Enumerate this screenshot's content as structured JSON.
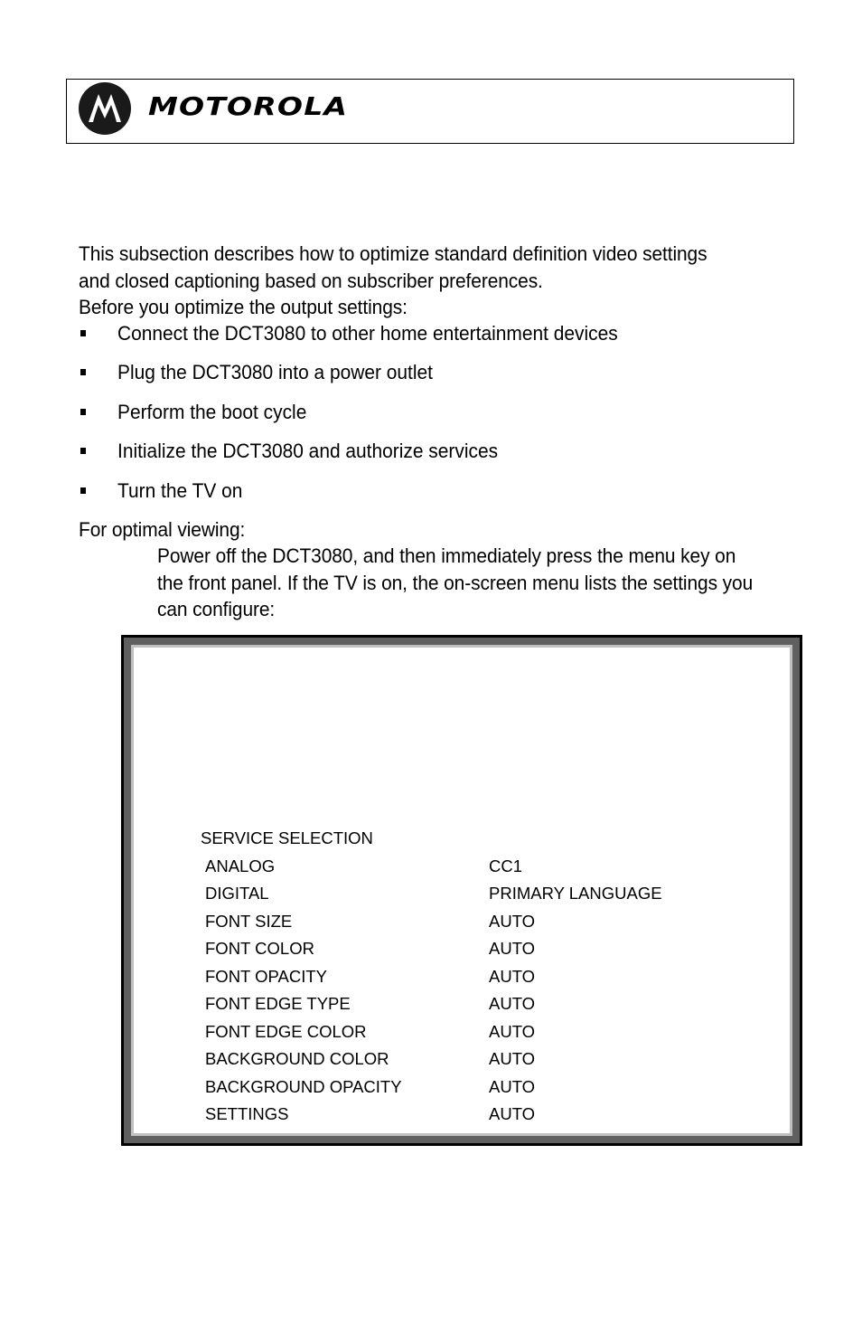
{
  "header": {
    "brand": "MOTOROLA",
    "logo_icon": "motorola-batwing-logo"
  },
  "intro": {
    "paragraph": "This subsection describes how to optimize standard definition video settings and closed captioning based on subscriber preferences.",
    "before_label": "Before you optimize the output settings:"
  },
  "prerequisites": [
    "Connect the DCT3080 to other home entertainment devices",
    "Plug the DCT3080 into a power outlet",
    "Perform the boot cycle",
    "Initialize the DCT3080 and authorize services",
    "Turn the TV on"
  ],
  "optimal": {
    "label": "For optimal viewing:",
    "instruction": "Power off the DCT3080, and then immediately press the menu key on the front panel. If the TV is on, the on-screen menu lists the settings you can configure:"
  },
  "tv_menu": {
    "title": "SERVICE SELECTION",
    "rows": [
      {
        "label": "ANALOG",
        "value": "CC1"
      },
      {
        "label": "DIGITAL",
        "value": "PRIMARY LANGUAGE"
      },
      {
        "label": "FONT SIZE",
        "value": "AUTO"
      },
      {
        "label": "FONT COLOR",
        "value": "AUTO"
      },
      {
        "label": "FONT OPACITY",
        "value": "AUTO"
      },
      {
        "label": "FONT EDGE TYPE",
        "value": "AUTO"
      },
      {
        "label": "FONT EDGE COLOR",
        "value": "AUTO"
      },
      {
        "label": "BACKGROUND COLOR",
        "value": "AUTO"
      },
      {
        "label": "BACKGROUND OPACITY",
        "value": "AUTO"
      },
      {
        "label": "SETTINGS",
        "value": "AUTO"
      }
    ]
  }
}
